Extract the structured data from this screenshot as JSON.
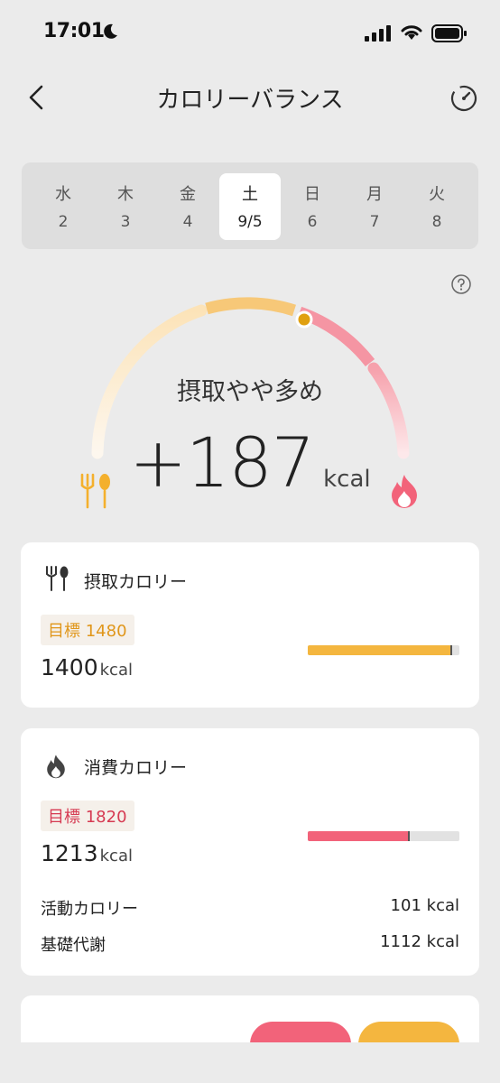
{
  "status_bar": {
    "time": "17:01"
  },
  "header": {
    "title": "カロリーバランス"
  },
  "days": [
    {
      "weekday": "水",
      "date": "2",
      "selected": false
    },
    {
      "weekday": "木",
      "date": "3",
      "selected": false
    },
    {
      "weekday": "金",
      "date": "4",
      "selected": false
    },
    {
      "weekday": "土",
      "date": "9/5",
      "selected": true
    },
    {
      "weekday": "日",
      "date": "6",
      "selected": false
    },
    {
      "weekday": "月",
      "date": "7",
      "selected": false
    },
    {
      "weekday": "火",
      "date": "8",
      "selected": false
    }
  ],
  "balance": {
    "status": "摂取やや多め",
    "value": "+187",
    "unit": "kcal"
  },
  "intake": {
    "title": "摂取カロリー",
    "target": "目標 1480",
    "value": "1400",
    "unit": "kcal",
    "progress": 0.946,
    "color": "#f4b63f"
  },
  "burn": {
    "title": "消費カロリー",
    "target": "目標 1820",
    "value": "1213",
    "unit": "kcal",
    "progress": 0.666,
    "color": "#f2637a",
    "rows": [
      {
        "label": "活動カロリー",
        "value": "101",
        "unit": "kcal"
      },
      {
        "label": "基礎代謝",
        "value": "1112",
        "unit": "kcal"
      }
    ]
  },
  "colors": {
    "accent_orange": "#f4b63f",
    "accent_red": "#f2637a",
    "target_orange": "#e0961a",
    "target_red": "#d63a52"
  }
}
